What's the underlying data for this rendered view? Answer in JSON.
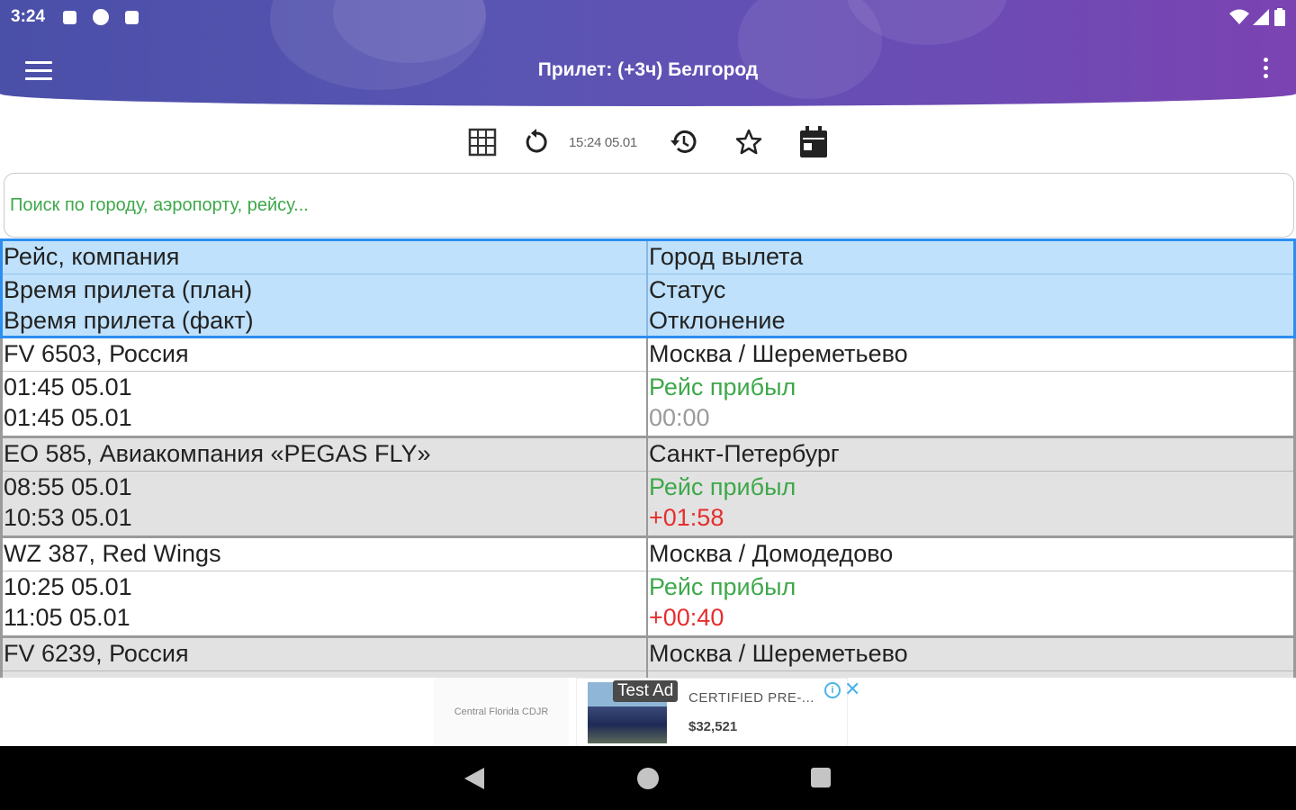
{
  "status_bar": {
    "time": "3:24"
  },
  "app_bar": {
    "title": "Прилет: (+3ч) Белгород"
  },
  "toolbar": {
    "updated_at": "15:24 05.01",
    "icons": [
      "grid-icon",
      "refresh-icon",
      "history-icon",
      "star-icon",
      "calendar-icon"
    ]
  },
  "search": {
    "placeholder": "Поиск по городу, аэропорту, рейсу..."
  },
  "table": {
    "header": {
      "left": [
        "Рейс, компания",
        "Время прилета (план)",
        "Время прилета (факт)"
      ],
      "right": [
        "Город вылета",
        "Статус",
        "Отклонение"
      ]
    },
    "rows": [
      {
        "flight": "FV 6503, Россия",
        "planned": "01:45 05.01",
        "actual": "01:45 05.01",
        "city": "Москва / Шереметьево",
        "status": "Рейс прибыл",
        "delay": "00:00"
      },
      {
        "flight": "EO 585, Авиакомпания «PEGAS FLY»",
        "planned": "08:55 05.01",
        "actual": "10:53 05.01",
        "city": "Санкт-Петербург",
        "status": "Рейс прибыл",
        "delay": "+01:58"
      },
      {
        "flight": "WZ 387, Red Wings",
        "planned": "10:25 05.01",
        "actual": "11:05 05.01",
        "city": "Москва / Домодедово",
        "status": "Рейс прибыл",
        "delay": "+00:40"
      },
      {
        "flight": "FV 6239, Россия",
        "city": "Москва / Шереметьево"
      }
    ]
  },
  "ad": {
    "left_text": "Central Florida CDJR",
    "tag": "Test Ad",
    "title": "CERTIFIED PRE-...",
    "price": "$32,521",
    "info": "i",
    "close": "✕"
  },
  "colors": {
    "header_bg": "#bfe1fb",
    "header_border": "#2d8df0",
    "status_green": "#3ea84a",
    "delay_red": "#e62e2e",
    "brand_purple": "#5a55b3"
  }
}
